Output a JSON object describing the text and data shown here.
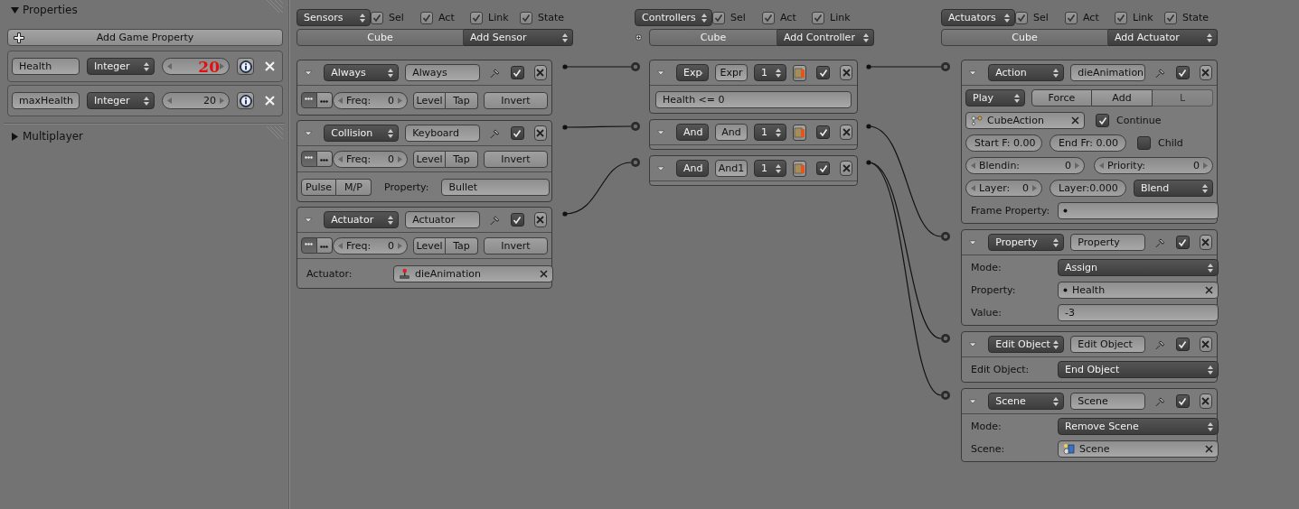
{
  "properties_panel": {
    "title": "Properties",
    "expanded": true,
    "add_button": "Add Game Property",
    "items": [
      {
        "name": "Health",
        "type": "Integer",
        "value": "20",
        "annotated": true
      },
      {
        "name": "maxHealth",
        "type": "Integer",
        "value": "20",
        "annotated": false
      }
    ]
  },
  "multiplayer_panel": {
    "title": "Multiplayer",
    "expanded": false
  },
  "sensors": {
    "menu": "Sensors",
    "filters": [
      {
        "label": "Sel",
        "checked": true
      },
      {
        "label": "Act",
        "checked": true
      },
      {
        "label": "Link",
        "checked": true
      },
      {
        "label": "State",
        "checked": true
      }
    ],
    "object": "Cube",
    "add_menu": "Add Sensor",
    "bricks": [
      {
        "type": "Always",
        "name": "Always",
        "active": true,
        "pulse_true": true,
        "pulse_false": false,
        "freq_label": "Freq:",
        "freq": "0",
        "level": "Level",
        "tap": "Tap",
        "invert": "Invert"
      },
      {
        "type": "Collision",
        "name": "Keyboard",
        "active": true,
        "pulse_true": true,
        "pulse_false": false,
        "freq_label": "Freq:",
        "freq": "0",
        "level": "Level",
        "tap": "Tap",
        "invert": "Invert",
        "extra": {
          "kind": "collision",
          "toggles": [
            {
              "label": "Pulse",
              "selected": false
            },
            {
              "label": "M/P",
              "selected": false
            }
          ],
          "label": "Property:",
          "value": "Bullet"
        }
      },
      {
        "type": "Actuator",
        "name": "Actuator",
        "active": true,
        "pulse_true": true,
        "pulse_false": false,
        "freq_label": "Freq:",
        "freq": "0",
        "level": "Level",
        "tap": "Tap",
        "invert": "Invert",
        "extra": {
          "kind": "actuator",
          "label": "Actuator:",
          "value": "dieAnimation"
        }
      }
    ]
  },
  "controllers": {
    "menu": "Controllers",
    "filters": [
      {
        "label": "Sel",
        "checked": true
      },
      {
        "label": "Act",
        "checked": true
      },
      {
        "label": "Link",
        "checked": true
      }
    ],
    "object": "Cube",
    "add_menu": "Add Controller",
    "bricks": [
      {
        "kind": "expression",
        "type": "Exp",
        "name": "Expr",
        "state": "1",
        "active": true,
        "expression": "Health <= 0"
      },
      {
        "kind": "logic",
        "type": "And",
        "name": "And",
        "state": "1",
        "active": true
      },
      {
        "kind": "logic",
        "type": "And",
        "name": "And1",
        "state": "1",
        "active": true
      }
    ]
  },
  "actuators": {
    "menu": "Actuators",
    "filters": [
      {
        "label": "Sel",
        "checked": true
      },
      {
        "label": "Act",
        "checked": true
      },
      {
        "label": "Link",
        "checked": true
      },
      {
        "label": "State",
        "checked": true
      }
    ],
    "object": "Cube",
    "add_menu": "Add Actuator",
    "bricks": [
      {
        "kind": "action",
        "type": "Action",
        "name": "dieAnimation",
        "active": true,
        "play_mode": "Play",
        "modes": [
          {
            "label": "Force",
            "disabled": false
          },
          {
            "label": "Add",
            "disabled": false
          },
          {
            "label": "L",
            "disabled": true
          }
        ],
        "action": "CubeAction",
        "continue": {
          "label": "Continue",
          "checked": true
        },
        "start": "Start F: 0.00",
        "end": "End Fr: 0.00",
        "child": {
          "label": "Child",
          "checked": false
        },
        "blendin_label": "Blendin:",
        "blendin": "0",
        "priority_label": "Priority:",
        "priority": "0",
        "layer_label": "Layer:",
        "layer": "0",
        "layer_weight": "Layer:0.000",
        "blend_mode": "Blend",
        "frame_property_label": "Frame Property:"
      },
      {
        "kind": "rows",
        "type": "Property",
        "name": "Property",
        "active": true,
        "rows": [
          {
            "kind": "menu",
            "label": "Mode:",
            "value": "Assign"
          },
          {
            "kind": "property",
            "label": "Property:",
            "value": "Health"
          },
          {
            "kind": "field",
            "label": "Value:",
            "value": "-3"
          }
        ]
      },
      {
        "kind": "rows",
        "type": "Edit Object",
        "name": "Edit Object",
        "active": true,
        "rows": [
          {
            "kind": "menu",
            "label": "Edit Object:",
            "value": "End Object"
          }
        ]
      },
      {
        "kind": "rows",
        "type": "Scene",
        "name": "Scene",
        "active": true,
        "rows": [
          {
            "kind": "menu",
            "label": "Mode:",
            "value": "Remove Scene"
          },
          {
            "kind": "scene",
            "label": "Scene:",
            "value": "Scene"
          }
        ]
      }
    ]
  }
}
